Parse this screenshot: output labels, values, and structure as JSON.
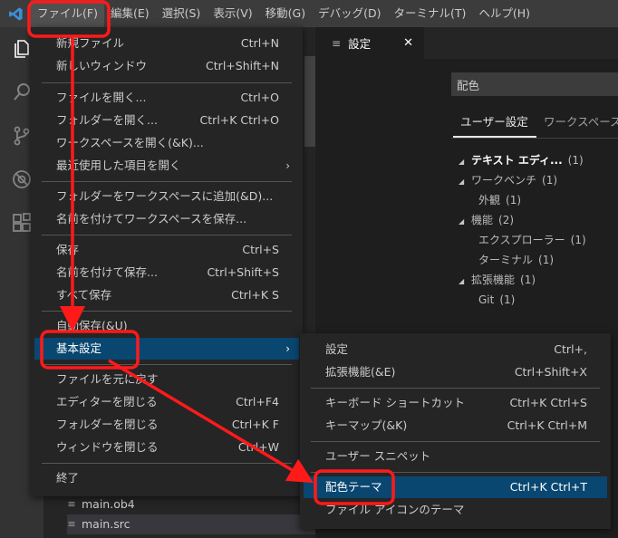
{
  "menubar": {
    "items": [
      "ファイル(F)",
      "編集(E)",
      "選択(S)",
      "表示(V)",
      "移動(G)",
      "デバッグ(D)",
      "ターミナル(T)",
      "ヘルプ(H)"
    ]
  },
  "activity_icons": [
    "files-icon",
    "search-icon",
    "source-control-icon",
    "debug-icon",
    "extensions-icon"
  ],
  "explorer": {
    "files": [
      "main.ob4",
      "main.src"
    ]
  },
  "editor": {
    "tab_label": "設定",
    "search_placeholder": "配色",
    "settings_tabs": [
      "ユーザー設定",
      "ワークスペース"
    ],
    "toc": [
      {
        "label": "テキスト エディ...",
        "count": "(1)"
      },
      {
        "label": "ワークベンチ",
        "count": "(1)"
      },
      {
        "label": "外観",
        "count": "(1)"
      },
      {
        "label": "機能",
        "count": "(2)"
      },
      {
        "label": "エクスプローラー",
        "count": "(1)"
      },
      {
        "label": "ターミナル",
        "count": "(1)"
      },
      {
        "label": "拡張機能",
        "count": "(1)"
      },
      {
        "label": "Git",
        "count": "(1)"
      }
    ]
  },
  "file_menu": {
    "items": [
      {
        "label": "新規ファイル",
        "shortcut": "Ctrl+N"
      },
      {
        "label": "新しいウィンドウ",
        "shortcut": "Ctrl+Shift+N"
      },
      {
        "label": "ファイルを開く...",
        "shortcut": "Ctrl+O"
      },
      {
        "label": "フォルダーを開く...",
        "shortcut": "Ctrl+K Ctrl+O"
      },
      {
        "label": "ワークスペースを開く(&K)...",
        "shortcut": ""
      },
      {
        "label": "最近使用した項目を開く",
        "shortcut": ""
      },
      {
        "label": "フォルダーをワークスペースに追加(&D)...",
        "shortcut": ""
      },
      {
        "label": "名前を付けてワークスペースを保存...",
        "shortcut": ""
      },
      {
        "label": "保存",
        "shortcut": "Ctrl+S"
      },
      {
        "label": "名前を付けて保存...",
        "shortcut": "Ctrl+Shift+S"
      },
      {
        "label": "すべて保存",
        "shortcut": "Ctrl+K S"
      },
      {
        "label": "自動保存(&U)",
        "shortcut": ""
      },
      {
        "label": "基本設定",
        "shortcut": ""
      },
      {
        "label": "ファイルを元に戻す",
        "shortcut": ""
      },
      {
        "label": "エディターを閉じる",
        "shortcut": "Ctrl+F4"
      },
      {
        "label": "フォルダーを閉じる",
        "shortcut": "Ctrl+K F"
      },
      {
        "label": "ウィンドウを閉じる",
        "shortcut": "Ctrl+W"
      },
      {
        "label": "終了",
        "shortcut": ""
      }
    ]
  },
  "pref_submenu": {
    "items": [
      {
        "label": "設定",
        "shortcut": "Ctrl+,"
      },
      {
        "label": "拡張機能(&E)",
        "shortcut": "Ctrl+Shift+X"
      },
      {
        "label": "キーボード ショートカット",
        "shortcut": "Ctrl+K Ctrl+S"
      },
      {
        "label": "キーマップ(&K)",
        "shortcut": "Ctrl+K Ctrl+M"
      },
      {
        "label": "ユーザー スニペット",
        "shortcut": ""
      },
      {
        "label": "配色テーマ",
        "shortcut": "Ctrl+K Ctrl+T"
      },
      {
        "label": "ファイル アイコンのテーマ",
        "shortcut": ""
      }
    ]
  },
  "colors": {
    "annotation": "#ff1a1a",
    "highlight": "#094771",
    "vscode_blue": "#3c8fd6"
  }
}
